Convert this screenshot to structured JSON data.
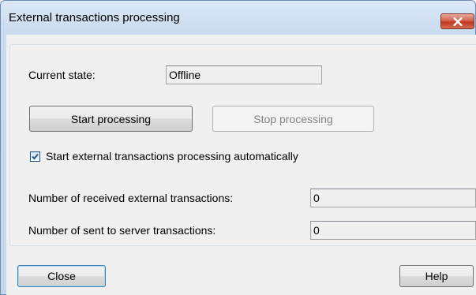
{
  "window": {
    "title": "External transactions processing"
  },
  "state": {
    "label": "Current state:",
    "value": "Offline"
  },
  "buttons": {
    "start": "Start processing",
    "stop": "Stop processing",
    "close": "Close",
    "help": "Help"
  },
  "auto_start": {
    "label": "Start external transactions processing automatically",
    "checked": true
  },
  "counters": {
    "received_label": "Number of received external transactions:",
    "received_value": "0",
    "sent_label": "Number of sent to server transactions:",
    "sent_value": "0"
  },
  "icons": {
    "close": "close-icon",
    "check": "checkmark-icon"
  },
  "colors": {
    "close_button": "#c94a35",
    "title_gradient": "#c9dbef",
    "check_color": "#2a5a8a"
  }
}
